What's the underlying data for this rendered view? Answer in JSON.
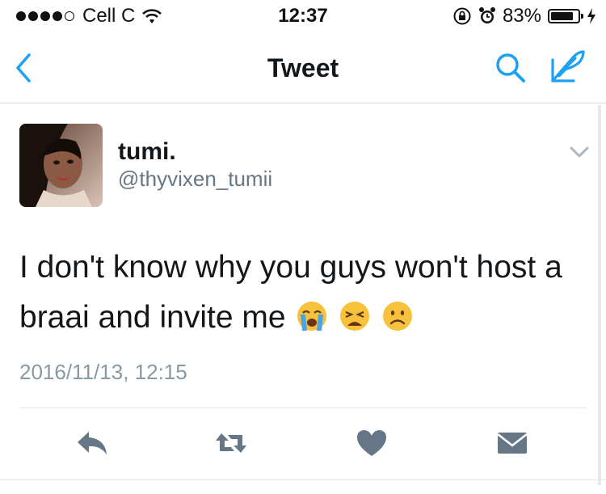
{
  "status_bar": {
    "carrier": "Cell C",
    "time": "12:37",
    "battery_percent": "83%",
    "battery_level": 0.83
  },
  "nav": {
    "title": "Tweet"
  },
  "tweet": {
    "display_name": "tumi.",
    "handle": "@thyvixen_tumii",
    "text": "I don't know why you guys won't host a braai and invite me",
    "timestamp": "2016/11/13, 12:15"
  },
  "icons": [
    "back-icon",
    "search-icon",
    "compose-icon",
    "caret-down-icon",
    "reply-icon",
    "retweet-icon",
    "like-icon",
    "direct-message-icon",
    "crying-emoji-icon",
    "weary-emoji-icon",
    "frowning-emoji-icon"
  ],
  "colors": {
    "accent": "#1da1f2",
    "action_gray": "#657786",
    "secondary_text": "#8899a6",
    "divider": "#e1e8ed"
  }
}
